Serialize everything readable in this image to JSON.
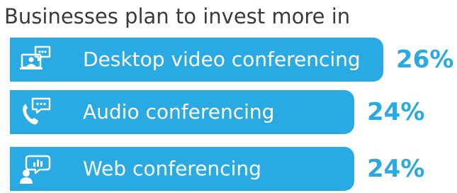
{
  "title": "Businesses plan to invest more in",
  "colors": {
    "bar": "#29aae2",
    "value_text": "#29aae2",
    "label_text": "#ffffff",
    "title_text": "#3a3a3a"
  },
  "chart_data": {
    "type": "bar",
    "orientation": "horizontal",
    "title": "Businesses plan to invest more in",
    "categories": [
      "Desktop video conferencing",
      "Audio conferencing",
      "Web conferencing"
    ],
    "values": [
      26,
      24,
      24
    ],
    "value_labels": [
      "26%",
      "24%",
      "24%"
    ],
    "icons": [
      "desktop-video-icon",
      "phone-chat-icon",
      "web-chat-icon"
    ],
    "xlabel": "",
    "ylabel": "",
    "grid": false,
    "legend": "none"
  }
}
